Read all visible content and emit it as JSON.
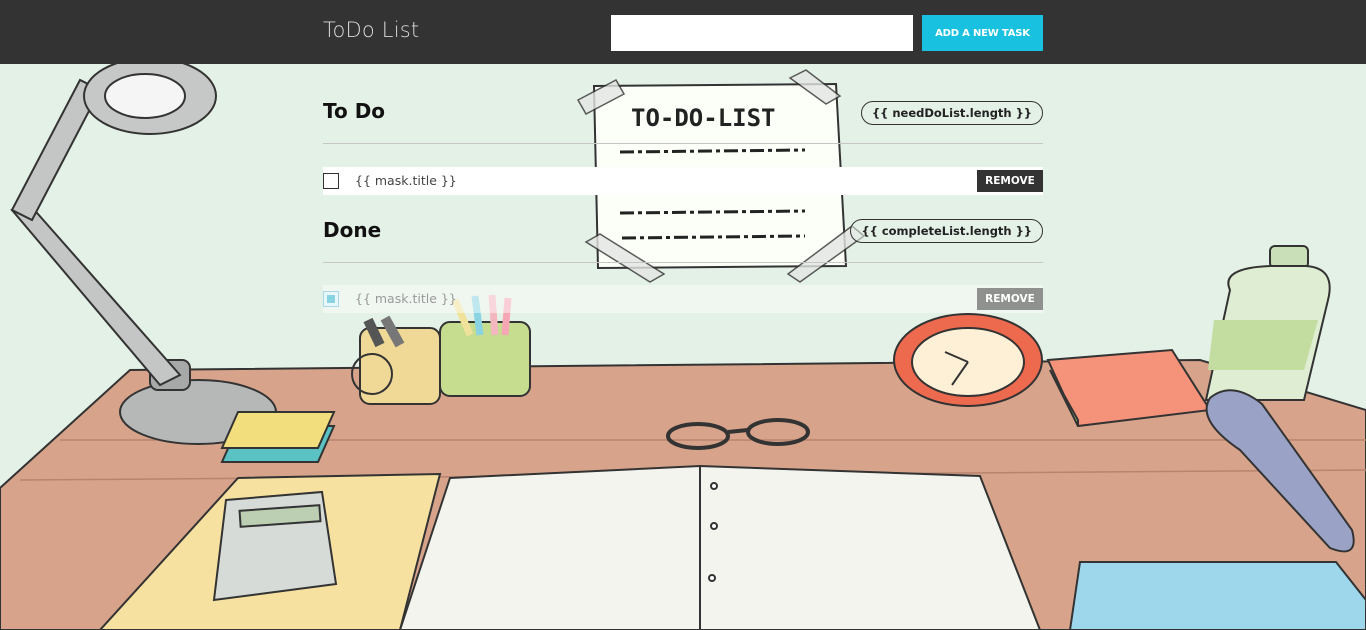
{
  "header": {
    "title": "ToDo List",
    "input_value": "",
    "add_button_label": "ADD A NEW TASK"
  },
  "todo_section": {
    "title": "To Do",
    "count_label": "{{ needDoList.length }}",
    "items": [
      {
        "title": "{{ mask.title }}",
        "checked": false,
        "remove_label": "REMOVE"
      }
    ]
  },
  "done_section": {
    "title": "Done",
    "count_label": "{{ completeList.length }}",
    "items": [
      {
        "title": "{{ mask.title }}",
        "checked": true,
        "remove_label": "REMOVE"
      }
    ]
  },
  "background": {
    "note_title": "TO-DO-LIST"
  },
  "colors": {
    "header_bg": "#333333",
    "accent": "#18c1e0",
    "remove_todo": "#333333",
    "remove_done": "#8f918e",
    "wall": "#e4f1e6",
    "desk": "#d7a48b"
  }
}
